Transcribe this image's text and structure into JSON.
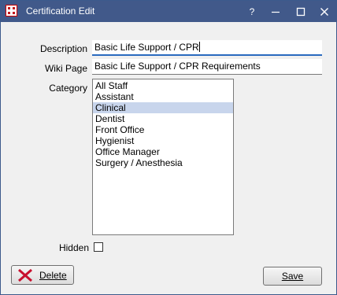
{
  "window": {
    "title": "Certification Edit",
    "help_label": "?",
    "minimize_icon": "minimize-icon",
    "maximize_icon": "maximize-icon",
    "close_icon": "close-icon",
    "title_bg": "#41598a"
  },
  "form": {
    "description_label": "Description",
    "description_value": "Basic Life Support / CPR",
    "wiki_label": "Wiki Page",
    "wiki_value": "Basic Life Support / CPR Requirements",
    "category_label": "Category",
    "categories": [
      "All Staff",
      "Assistant",
      "Clinical",
      "Dentist",
      "Front Office",
      "Hygienist",
      "Office Manager",
      "Surgery / Anesthesia"
    ],
    "selected_category": "Clinical",
    "hidden_label": "Hidden",
    "hidden_checked": false
  },
  "buttons": {
    "delete_label": "Delete",
    "delete_icon": "red-x-icon",
    "save_label": "Save"
  }
}
